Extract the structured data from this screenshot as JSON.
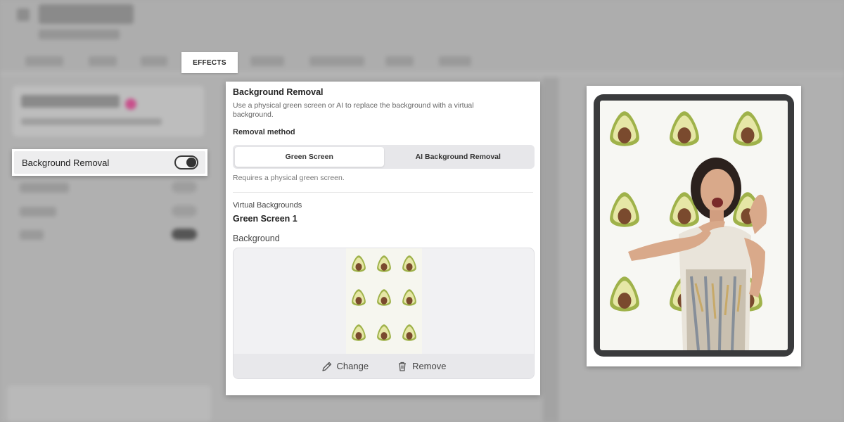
{
  "tabs": {
    "effects": "EFFECTS"
  },
  "left": {
    "toggle_label": "Background Removal",
    "toggle_on": true
  },
  "panel": {
    "title": "Background Removal",
    "description": "Use a physical green screen or AI to replace the background with a virtual background.",
    "method_label": "Removal method",
    "methods": [
      "Green Screen",
      "AI Background Removal"
    ],
    "selected_method": "Green Screen",
    "hint": "Requires a physical green screen.",
    "virtual_label": "Virtual Backgrounds",
    "screen_name": "Green Screen 1",
    "background_label": "Background",
    "change_label": "Change",
    "remove_label": "Remove"
  },
  "icons": {
    "pencil": "pencil-icon",
    "trash": "trash-icon"
  },
  "colors": {
    "accent_pink": "#c8508c",
    "toggle_dark": "#333333",
    "avocado_skin": "#9fb24a",
    "avocado_flesh": "#e6e7a6",
    "avocado_pit": "#7a4a2e"
  }
}
